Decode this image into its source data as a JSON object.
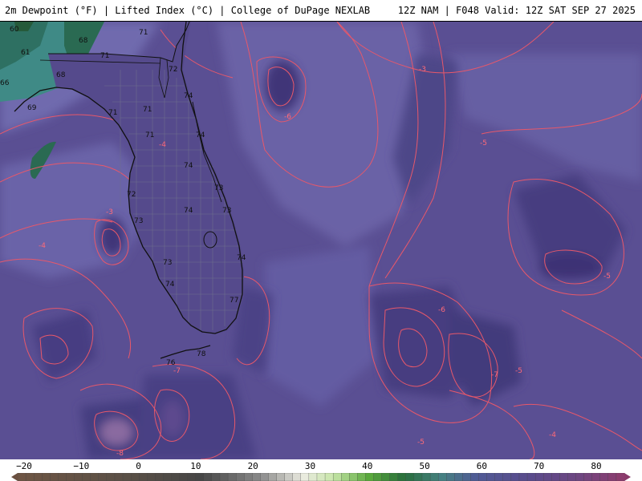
{
  "header": {
    "left_text": "2m Dewpoint (°F) | Lifted Index (°C) | College of DuPage NEXLAB",
    "right_text": "12Z NAM | F048 Valid: 12Z SAT SEP 27 2025"
  },
  "legend": {
    "ticks": [
      "−20",
      "−10",
      "0",
      "10",
      "20",
      "30",
      "40",
      "50",
      "60",
      "70",
      "80"
    ]
  },
  "colors": {
    "ocean_base": "#5a4f93",
    "ocean_light": "#6c63a8",
    "ocean_dark": "#463c80",
    "ocean_darkest": "#3a2f70",
    "green_dark": "#2f6a55",
    "green_light": "#4a8e84",
    "contour_red": "#e8586a",
    "coast_black": "#101010",
    "county_gray": "#6e6e8c"
  },
  "dewpoint_labels": [
    {
      "text": "65"
    },
    {
      "text": "60"
    },
    {
      "text": "61"
    },
    {
      "text": "68"
    },
    {
      "text": "71"
    },
    {
      "text": "71"
    },
    {
      "text": "66"
    },
    {
      "text": "68"
    },
    {
      "text": "69"
    },
    {
      "text": "72"
    },
    {
      "text": "74"
    },
    {
      "text": "71"
    },
    {
      "text": "71"
    },
    {
      "text": "71"
    },
    {
      "text": "74"
    },
    {
      "text": "74"
    },
    {
      "text": "73"
    },
    {
      "text": "72"
    },
    {
      "text": "74"
    },
    {
      "text": "73"
    },
    {
      "text": "73"
    },
    {
      "text": "74"
    },
    {
      "text": "73"
    },
    {
      "text": "74"
    },
    {
      "text": "77"
    },
    {
      "text": "76"
    },
    {
      "text": "78"
    }
  ],
  "lifted_index_labels": [
    {
      "text": "-3"
    },
    {
      "text": "-6"
    },
    {
      "text": "-4"
    },
    {
      "text": "-5"
    },
    {
      "text": "-3"
    },
    {
      "text": "-4"
    },
    {
      "text": "-5"
    },
    {
      "text": "-6"
    },
    {
      "text": "-7"
    },
    {
      "text": "-5"
    },
    {
      "text": "-7"
    },
    {
      "text": "-5"
    },
    {
      "text": "-4"
    },
    {
      "text": "-8"
    }
  ]
}
